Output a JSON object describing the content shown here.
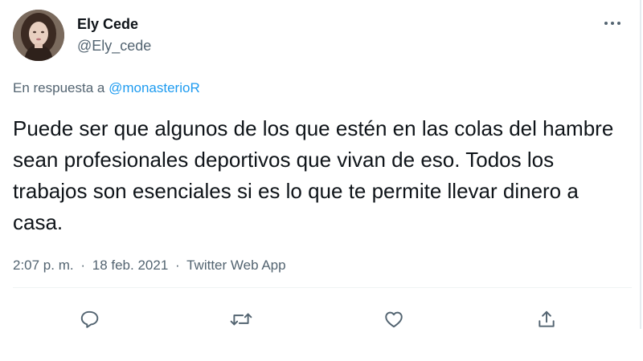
{
  "author": {
    "name": "Ely Cede",
    "handle": "@Ely_cede"
  },
  "reply": {
    "prefix": "En respuesta a",
    "mention": "@monasterioR"
  },
  "tweet": {
    "text": "Puede ser que algunos de los que estén en las colas del hambre sean profesionales deportivos que vivan de eso. Todos los trabajos son esenciales si es lo que te permite llevar dinero a casa."
  },
  "meta": {
    "time": "2:07 p. m.",
    "separator": "·",
    "date": "18 feb. 2021",
    "source": "Twitter Web App"
  },
  "icons": {
    "more": "more-horizontal-icon",
    "reply": "reply-icon",
    "retweet": "retweet-icon",
    "like": "like-icon",
    "share": "share-icon"
  },
  "colors": {
    "text": "#0f1419",
    "secondary": "#536471",
    "link": "#1d9bf0",
    "divider": "#eff3f4"
  }
}
